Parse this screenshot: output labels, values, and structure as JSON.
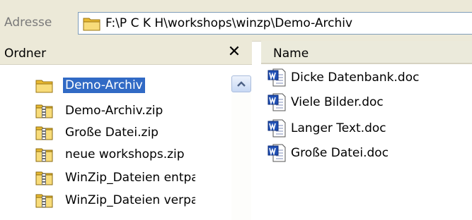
{
  "address_bar": {
    "label": "Adresse",
    "path": "F:\\P C K H\\workshops\\winzp\\Demo-Archiv",
    "folder_icon": "folder-icon"
  },
  "folder_pane": {
    "title": "Ordner",
    "close_glyph": "✕",
    "items": [
      {
        "label": "Demo-Archiv",
        "icon": "folder-icon",
        "selected": true
      },
      {
        "label": "Demo-Archiv.zip",
        "icon": "zip-folder-icon"
      },
      {
        "label": "Große Datei.zip",
        "icon": "zip-folder-icon"
      },
      {
        "label": "neue workshops.zip",
        "icon": "zip-folder-icon"
      },
      {
        "label": "WinZip_Dateien entpacken",
        "icon": "zip-folder-icon"
      },
      {
        "label": "WinZip_Dateien verpacken",
        "icon": "zip-folder-icon"
      }
    ]
  },
  "file_pane": {
    "column_name": "Name",
    "files": [
      {
        "label": "Dicke Datenbank.doc",
        "icon": "word-doc-icon"
      },
      {
        "label": "Viele Bilder.doc",
        "icon": "word-doc-icon"
      },
      {
        "label": "Langer Text.doc",
        "icon": "word-doc-icon"
      },
      {
        "label": "Große Datei.doc",
        "icon": "word-doc-icon"
      }
    ]
  },
  "colors": {
    "selection": "#316ac5",
    "chrome": "#ece9d8",
    "folder_yellow": "#f5d76e",
    "word_blue": "#1f4fb4"
  }
}
